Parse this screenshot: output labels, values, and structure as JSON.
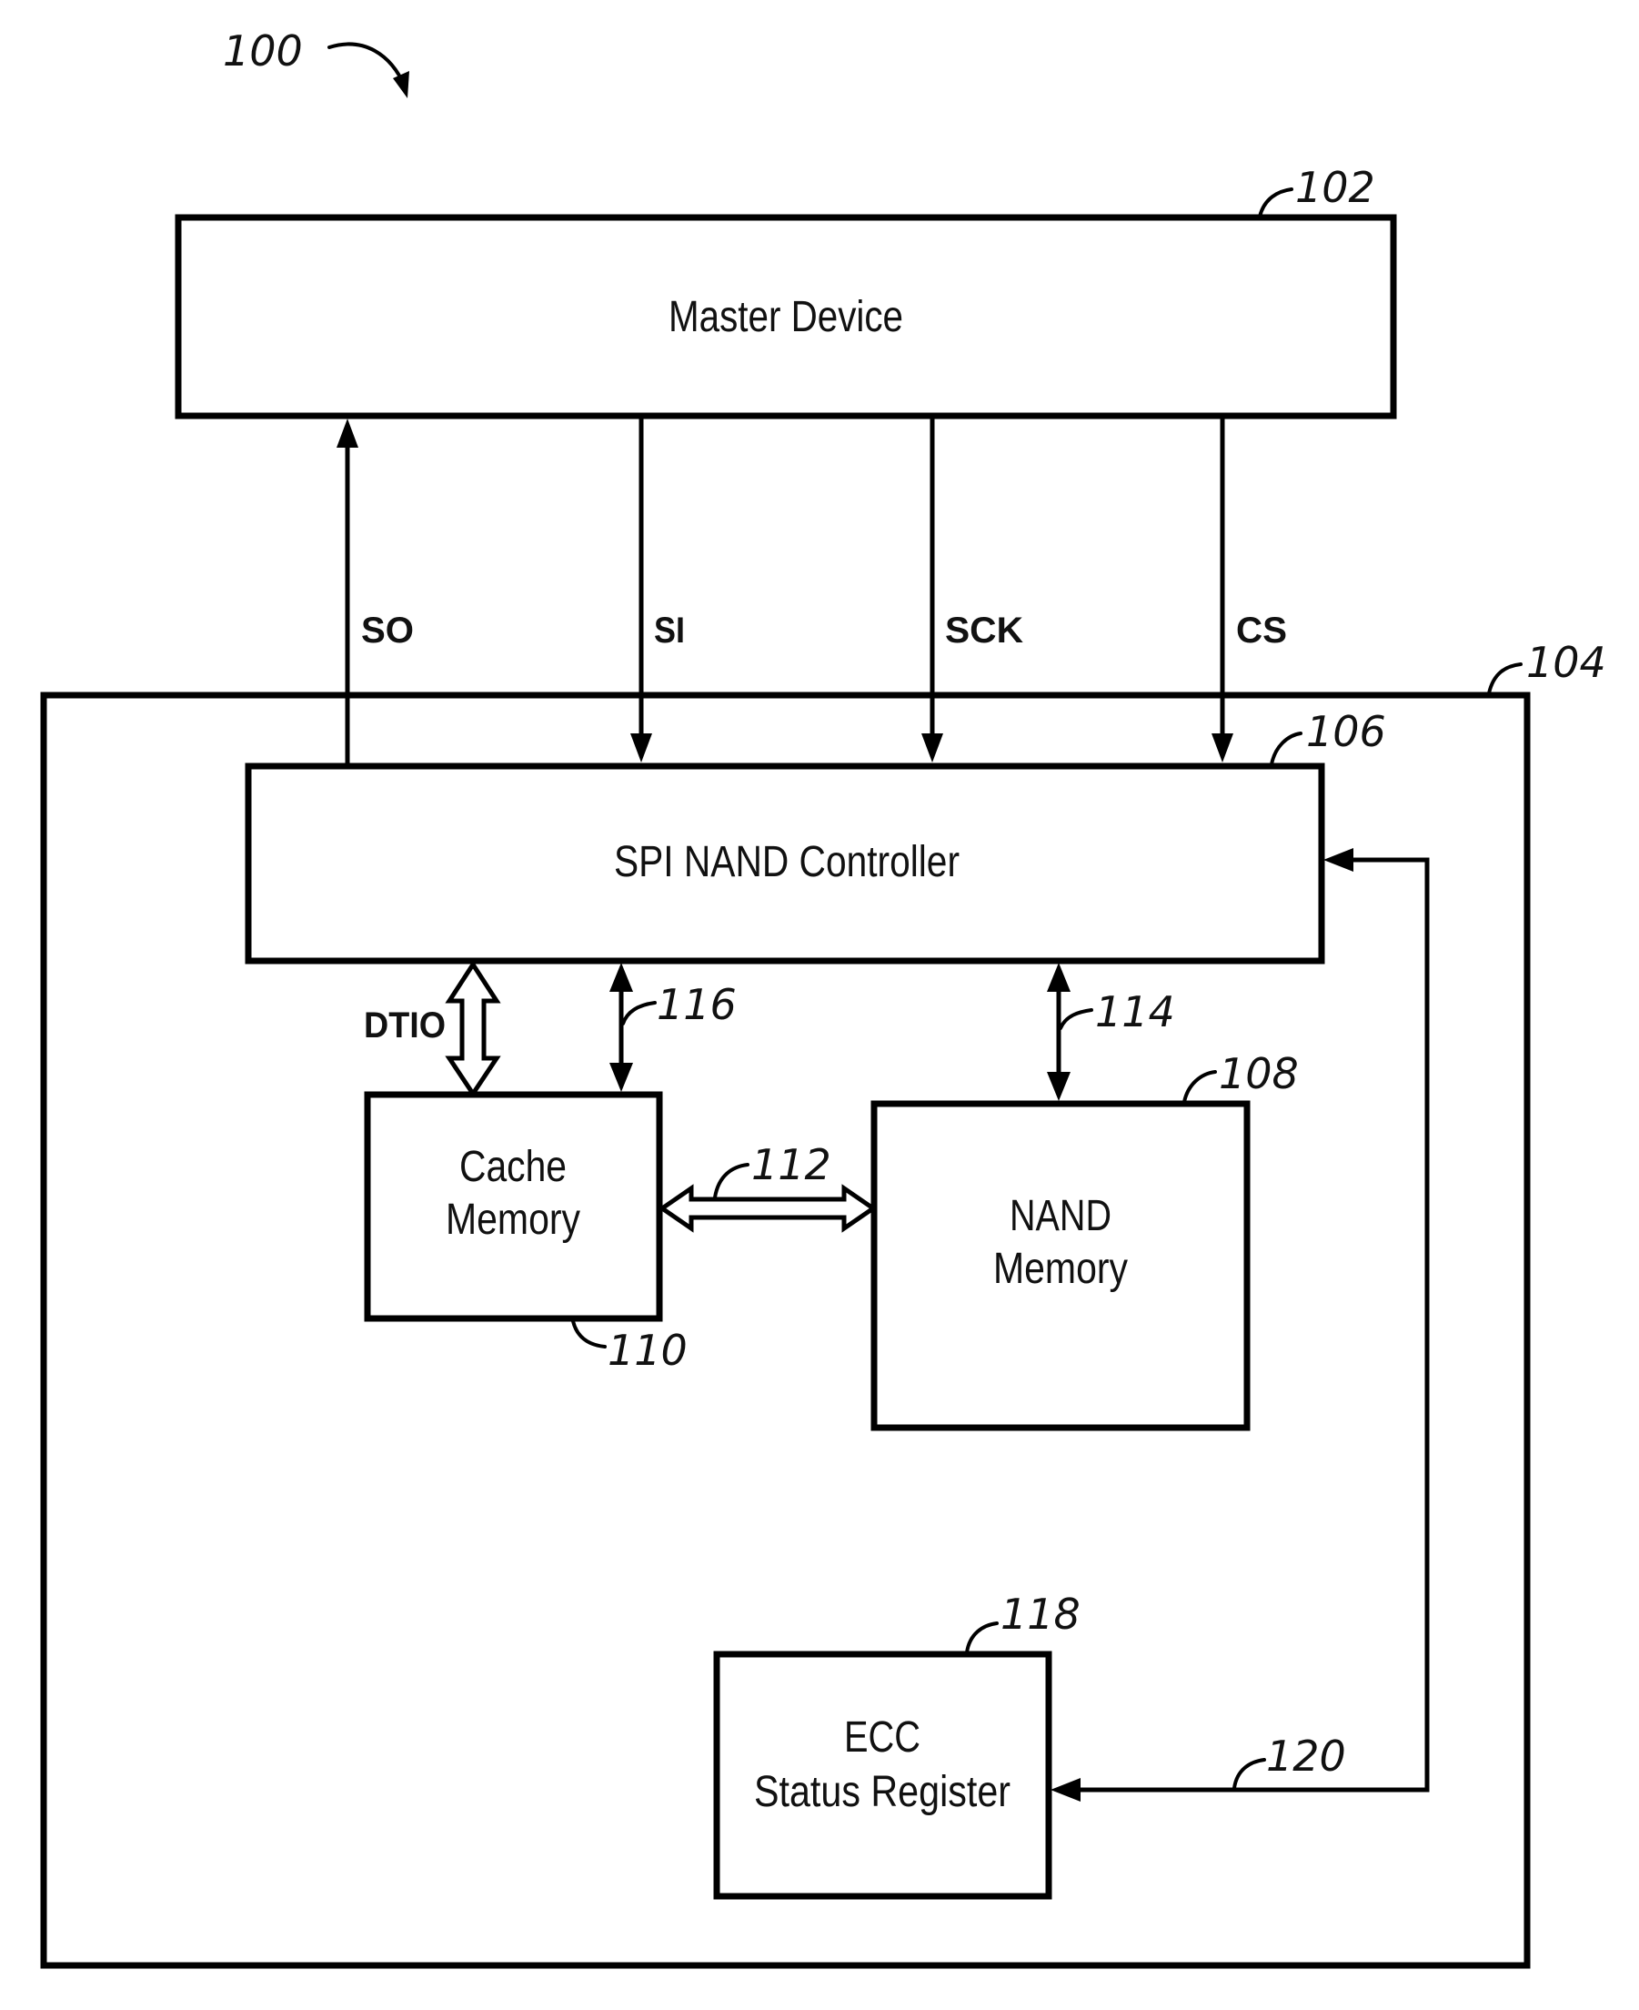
{
  "figure": {
    "reference": "100"
  },
  "blocks": {
    "master": {
      "label": "Master Device",
      "ref": "102"
    },
    "device": {
      "ref": "104"
    },
    "controller": {
      "label": "SPI NAND Controller",
      "ref": "106"
    },
    "nand": {
      "line1": "NAND",
      "line2": "Memory",
      "ref": "108"
    },
    "cache": {
      "line1": "Cache",
      "line2": "Memory",
      "ref": "110"
    },
    "ecc": {
      "line1": "ECC",
      "line2": "Status Register",
      "ref": "118"
    }
  },
  "signals": {
    "so": "SO",
    "si": "SI",
    "sck": "SCK",
    "cs": "CS",
    "dtio": "DTIO"
  },
  "connections": {
    "cache_nand": "112",
    "controller_nand": "114",
    "controller_cache": "116",
    "ecc_feedback": "120"
  }
}
